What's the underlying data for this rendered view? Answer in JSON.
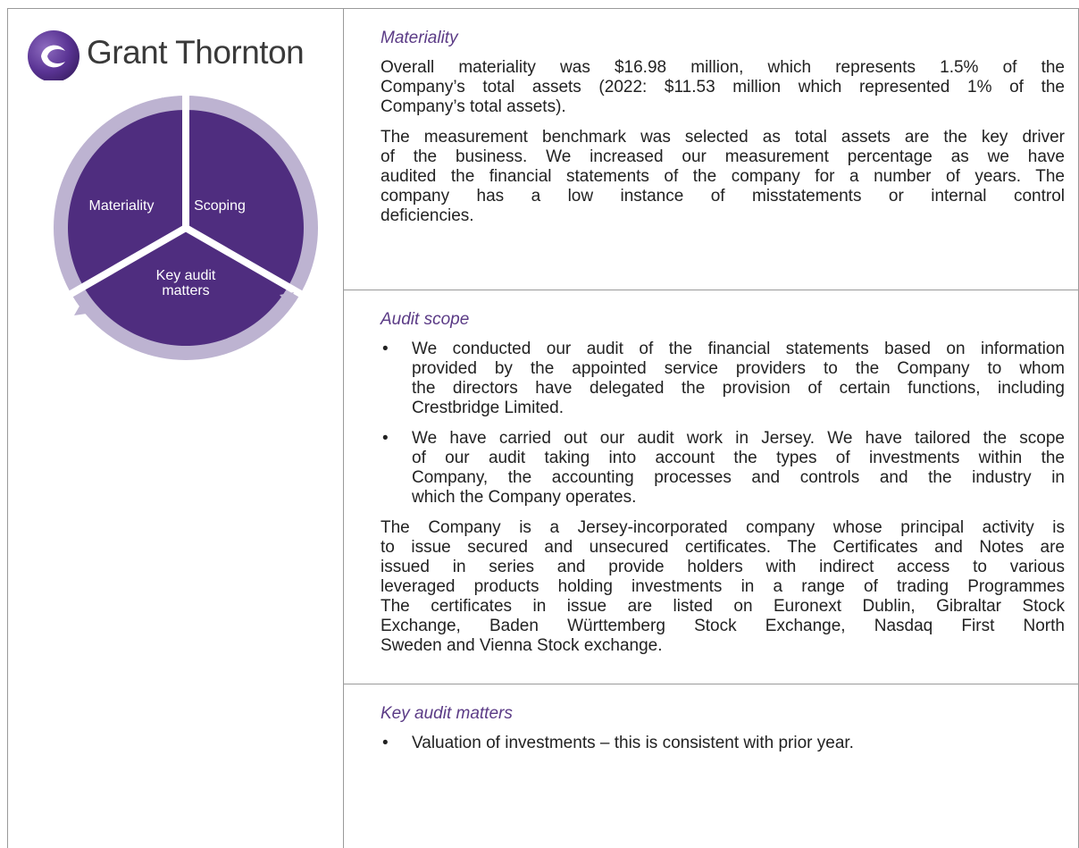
{
  "brand": {
    "name": "Grant Thornton",
    "colors": {
      "purple": "#4f2d7f",
      "ring": "#bdb3d1",
      "heading": "#5b3b86"
    }
  },
  "cycle": {
    "segments": [
      "Materiality",
      "Scoping"
    ],
    "bottom_lines": [
      "Key audit",
      "matters"
    ]
  },
  "materiality": {
    "heading": "Materiality",
    "para1_lines": [
      "Overall materiality was $16.98 million, which represents 1.5% of the",
      "Company’s total assets (2022: $11.53 million which represented 1% of the",
      "Company’s total assets)."
    ],
    "para2_lines": [
      "The measurement benchmark was selected as total assets are the key driver",
      "of the business. We increased our measurement percentage as we have",
      "audited the financial statements of the company for a number of years. The",
      "company has a low instance of misstatements or internal control",
      "deficiencies."
    ]
  },
  "audit_scope": {
    "heading": "Audit scope",
    "bullets": [
      [
        "We conducted our audit of the financial statements based on information",
        "provided by the appointed service providers to the Company to whom",
        "the directors have delegated the provision of certain functions, including",
        "Crestbridge Limited."
      ],
      [
        "We have carried out our audit work in Jersey. We have tailored the scope",
        "of our audit taking into account the types of investments within the",
        "Company, the accounting processes and controls and the industry in",
        "which the Company operates."
      ]
    ],
    "para_lines": [
      "The Company is a Jersey-incorporated company whose principal activity is",
      "to issue secured and unsecured certificates. The Certificates and Notes are",
      "issued in series and provide holders with indirect access to various",
      "leveraged products holding investments in a range of trading Programmes",
      "The certificates in issue are listed on Euronext Dublin, Gibraltar Stock",
      "Exchange, Baden Württemberg Stock Exchange, Nasdaq First North",
      "Sweden and Vienna Stock exchange."
    ]
  },
  "key_audit_matters": {
    "heading": "Key audit matters",
    "bullets": [
      "Valuation of investments – this is consistent with prior year."
    ]
  }
}
